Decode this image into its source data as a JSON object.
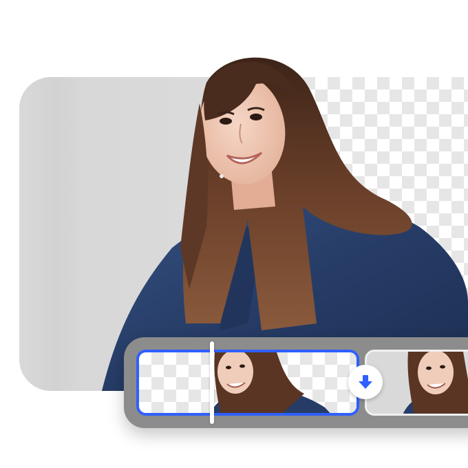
{
  "colors": {
    "accent": "#2f5fff",
    "card_gray": "#d6d6d6",
    "filmstrip_gray": "#8c8c8c",
    "shirt": "#2a3f6b",
    "hair": "#5a3524"
  },
  "icons": {
    "download": "arrow-down-icon"
  },
  "preview": {
    "left_mode": "original-background",
    "right_mode": "transparent-background"
  },
  "filmstrip": {
    "selected_index": 0,
    "thumbnail_count": 2
  }
}
